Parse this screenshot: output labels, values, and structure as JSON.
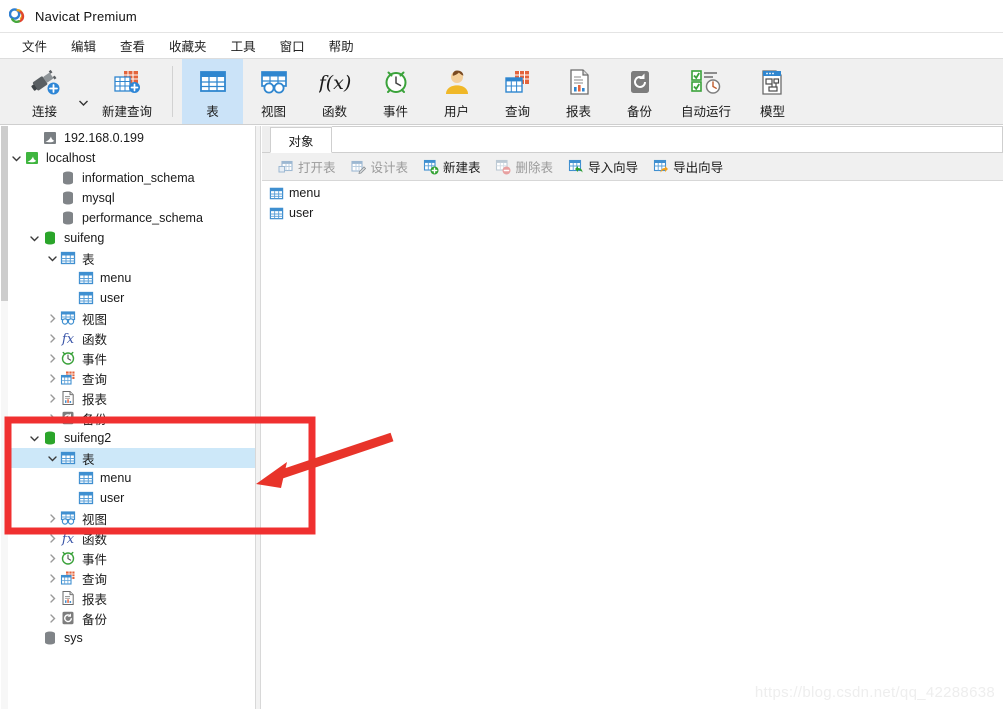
{
  "window": {
    "title": "Navicat Premium",
    "logo_icon": "navicat-logo-icon"
  },
  "menubar": {
    "items": [
      {
        "label": "文件",
        "name": "menu-file"
      },
      {
        "label": "编辑",
        "name": "menu-edit"
      },
      {
        "label": "查看",
        "name": "menu-view"
      },
      {
        "label": "收藏夹",
        "name": "menu-favorites"
      },
      {
        "label": "工具",
        "name": "menu-tools"
      },
      {
        "label": "窗口",
        "name": "menu-window"
      },
      {
        "label": "帮助",
        "name": "menu-help"
      }
    ]
  },
  "toolbar": {
    "buttons": [
      {
        "label": "连接",
        "icon": "connection-icon",
        "selected": false
      },
      {
        "label": "新建查询",
        "icon": "new-query-icon",
        "selected": false
      },
      {
        "label": "表",
        "icon": "table-icon",
        "selected": true
      },
      {
        "label": "视图",
        "icon": "view-icon",
        "selected": false
      },
      {
        "label": "函数",
        "icon": "function-icon",
        "selected": false
      },
      {
        "label": "事件",
        "icon": "event-icon",
        "selected": false
      },
      {
        "label": "用户",
        "icon": "user-icon",
        "selected": false
      },
      {
        "label": "查询",
        "icon": "query-icon",
        "selected": false
      },
      {
        "label": "报表",
        "icon": "report-icon",
        "selected": false
      },
      {
        "label": "备份",
        "icon": "backup-icon",
        "selected": false
      },
      {
        "label": "自动运行",
        "icon": "automation-icon",
        "selected": false
      },
      {
        "label": "模型",
        "icon": "model-icon",
        "selected": false
      }
    ]
  },
  "sidebar": {
    "tree": [
      {
        "label": "192.168.0.199",
        "icon": "connection-gray-icon",
        "indent": 1,
        "chevron": "none",
        "selected": false
      },
      {
        "label": "localhost",
        "icon": "connection-green-icon",
        "indent": 0,
        "chevron": "down",
        "selected": false
      },
      {
        "label": "information_schema",
        "icon": "database-gray-icon",
        "indent": 2,
        "chevron": "none",
        "selected": false
      },
      {
        "label": "mysql",
        "icon": "database-gray-icon",
        "indent": 2,
        "chevron": "none",
        "selected": false
      },
      {
        "label": "performance_schema",
        "icon": "database-gray-icon",
        "indent": 2,
        "chevron": "none",
        "selected": false
      },
      {
        "label": "suifeng",
        "icon": "database-green-icon",
        "indent": 1,
        "chevron": "down",
        "selected": false
      },
      {
        "label": "表",
        "icon": "table-folder-icon",
        "indent": 2,
        "chevron": "down",
        "selected": false
      },
      {
        "label": "menu",
        "icon": "table-item-icon",
        "indent": 3,
        "chevron": "none",
        "selected": false
      },
      {
        "label": "user",
        "icon": "table-item-icon",
        "indent": 3,
        "chevron": "none",
        "selected": false
      },
      {
        "label": "视图",
        "icon": "view-folder-icon",
        "indent": 2,
        "chevron": "right",
        "selected": false
      },
      {
        "label": "函数",
        "icon": "function-folder-icon",
        "indent": 2,
        "chevron": "right",
        "selected": false
      },
      {
        "label": "事件",
        "icon": "event-folder-icon",
        "indent": 2,
        "chevron": "right",
        "selected": false
      },
      {
        "label": "查询",
        "icon": "query-folder-icon",
        "indent": 2,
        "chevron": "right",
        "selected": false
      },
      {
        "label": "报表",
        "icon": "report-folder-icon",
        "indent": 2,
        "chevron": "right",
        "selected": false
      },
      {
        "label": "备份",
        "icon": "backup-folder-icon",
        "indent": 2,
        "chevron": "right",
        "selected": false
      },
      {
        "label": "suifeng2",
        "icon": "database-green-icon",
        "indent": 1,
        "chevron": "down",
        "selected": false
      },
      {
        "label": "表",
        "icon": "table-folder-icon",
        "indent": 2,
        "chevron": "down",
        "selected": true
      },
      {
        "label": "menu",
        "icon": "table-item-icon",
        "indent": 3,
        "chevron": "none",
        "selected": false
      },
      {
        "label": "user",
        "icon": "table-item-icon",
        "indent": 3,
        "chevron": "none",
        "selected": false
      },
      {
        "label": "视图",
        "icon": "view-folder-icon",
        "indent": 2,
        "chevron": "right",
        "selected": false
      },
      {
        "label": "函数",
        "icon": "function-folder-icon",
        "indent": 2,
        "chevron": "right",
        "selected": false
      },
      {
        "label": "事件",
        "icon": "event-folder-icon",
        "indent": 2,
        "chevron": "right",
        "selected": false
      },
      {
        "label": "查询",
        "icon": "query-folder-icon",
        "indent": 2,
        "chevron": "right",
        "selected": false
      },
      {
        "label": "报表",
        "icon": "report-folder-icon",
        "indent": 2,
        "chevron": "right",
        "selected": false
      },
      {
        "label": "备份",
        "icon": "backup-folder-icon",
        "indent": 2,
        "chevron": "right",
        "selected": false
      },
      {
        "label": "sys",
        "icon": "database-gray-icon",
        "indent": 1,
        "chevron": "none",
        "selected": false
      }
    ]
  },
  "right_pane": {
    "tabs": [
      {
        "label": "对象",
        "active": true
      }
    ],
    "object_toolbar": [
      {
        "label": "打开表",
        "icon": "open-table-icon",
        "disabled": true
      },
      {
        "label": "设计表",
        "icon": "design-table-icon",
        "disabled": true
      },
      {
        "label": "新建表",
        "icon": "new-table-icon",
        "disabled": false
      },
      {
        "label": "删除表",
        "icon": "delete-table-icon",
        "disabled": true
      },
      {
        "label": "导入向导",
        "icon": "import-wizard-icon",
        "disabled": false
      },
      {
        "label": "导出向导",
        "icon": "export-wizard-icon",
        "disabled": false
      }
    ],
    "objects": [
      {
        "label": "menu",
        "icon": "table-item-icon"
      },
      {
        "label": "user",
        "icon": "table-item-icon"
      }
    ]
  },
  "annotations": {
    "highlight_rect": {
      "color": "#f03030"
    },
    "arrow": {
      "color": "#e8342a"
    }
  },
  "watermark": {
    "text": "https://blog.csdn.net/qq_42288638"
  },
  "colors": {
    "accent": "#cbe3f8",
    "selection": "#cde8f9",
    "annotation_red": "#f03030",
    "toolbar_bg": "#f0f0f0"
  }
}
